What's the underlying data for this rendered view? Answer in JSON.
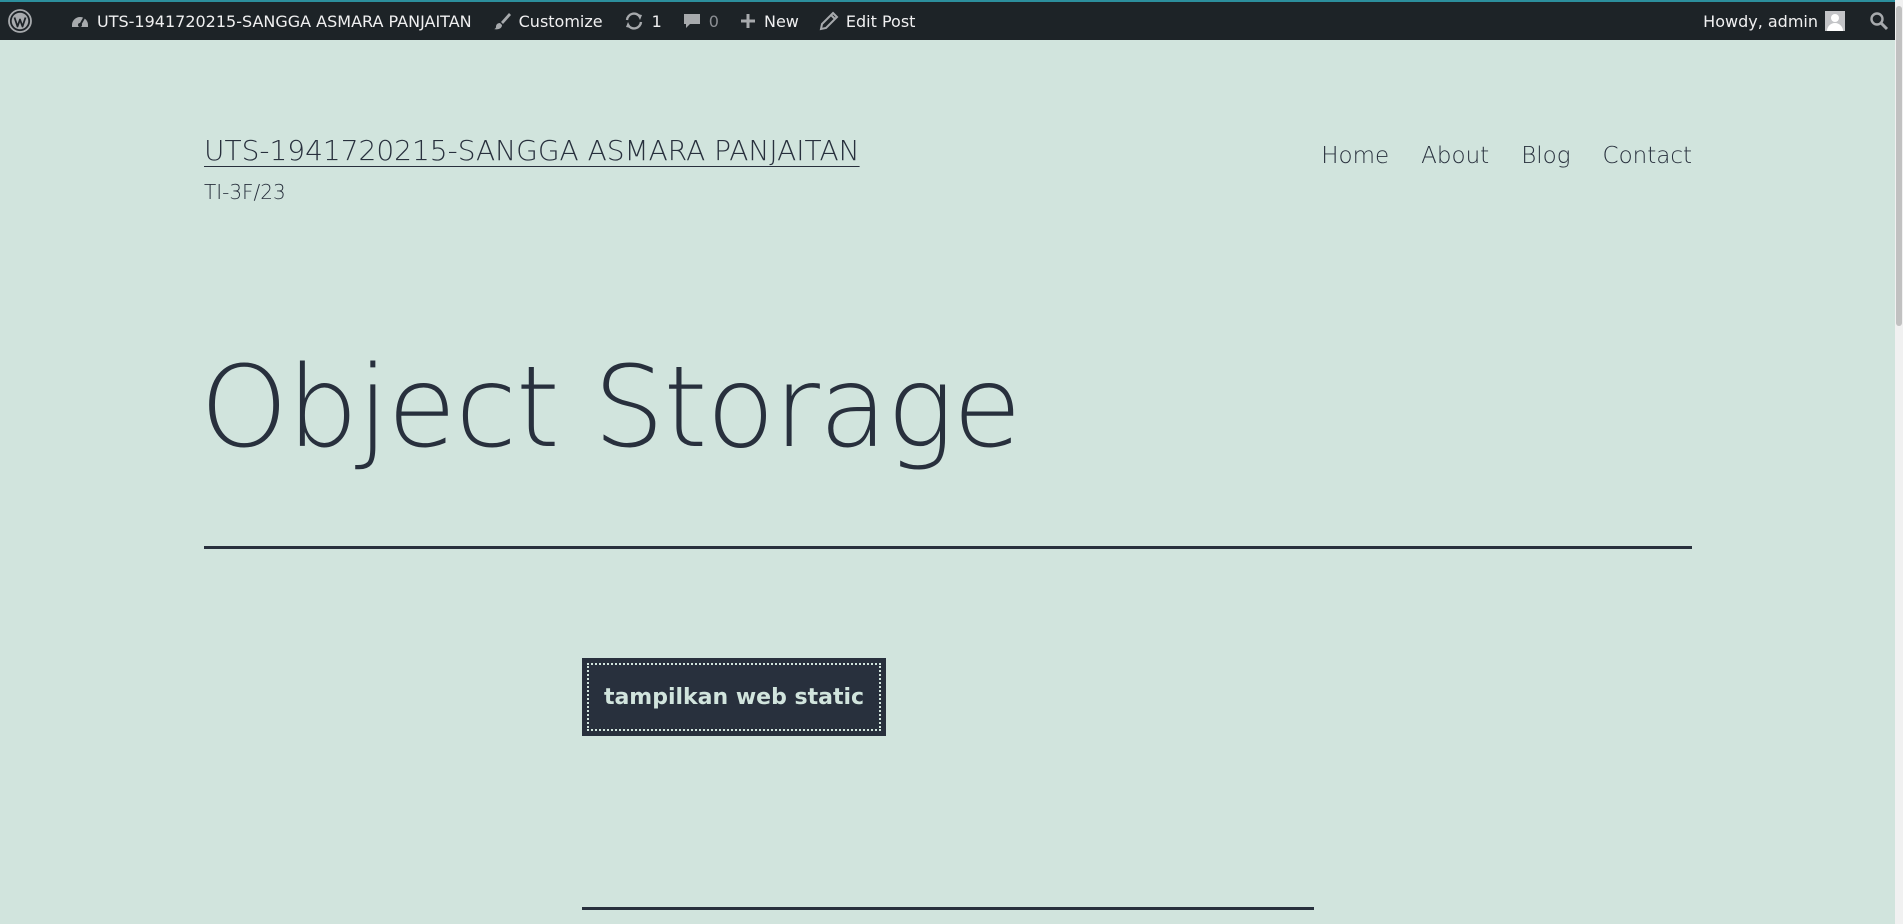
{
  "admin_bar": {
    "wp_logo_icon": "wordpress-logo-icon",
    "site_name": "UTS-1941720215-SANGGA ASMARA PANJAITAN",
    "customize_label": "Customize",
    "updates_count": "1",
    "comments_count": "0",
    "new_label": "New",
    "edit_post_label": "Edit Post",
    "greeting": "Howdy, admin",
    "search_icon": "search-icon"
  },
  "header": {
    "site_title": "UTS-1941720215-SANGGA ASMARA PANJAITAN",
    "site_description": "TI-3F/23",
    "nav": [
      "Home",
      "About",
      "Blog",
      "Contact"
    ]
  },
  "page": {
    "title": "Object Storage",
    "button_label": "tampilkan web static"
  },
  "colors": {
    "background": "#d1e4dd",
    "text": "#28303d",
    "admin_bar": "#1d2327"
  }
}
